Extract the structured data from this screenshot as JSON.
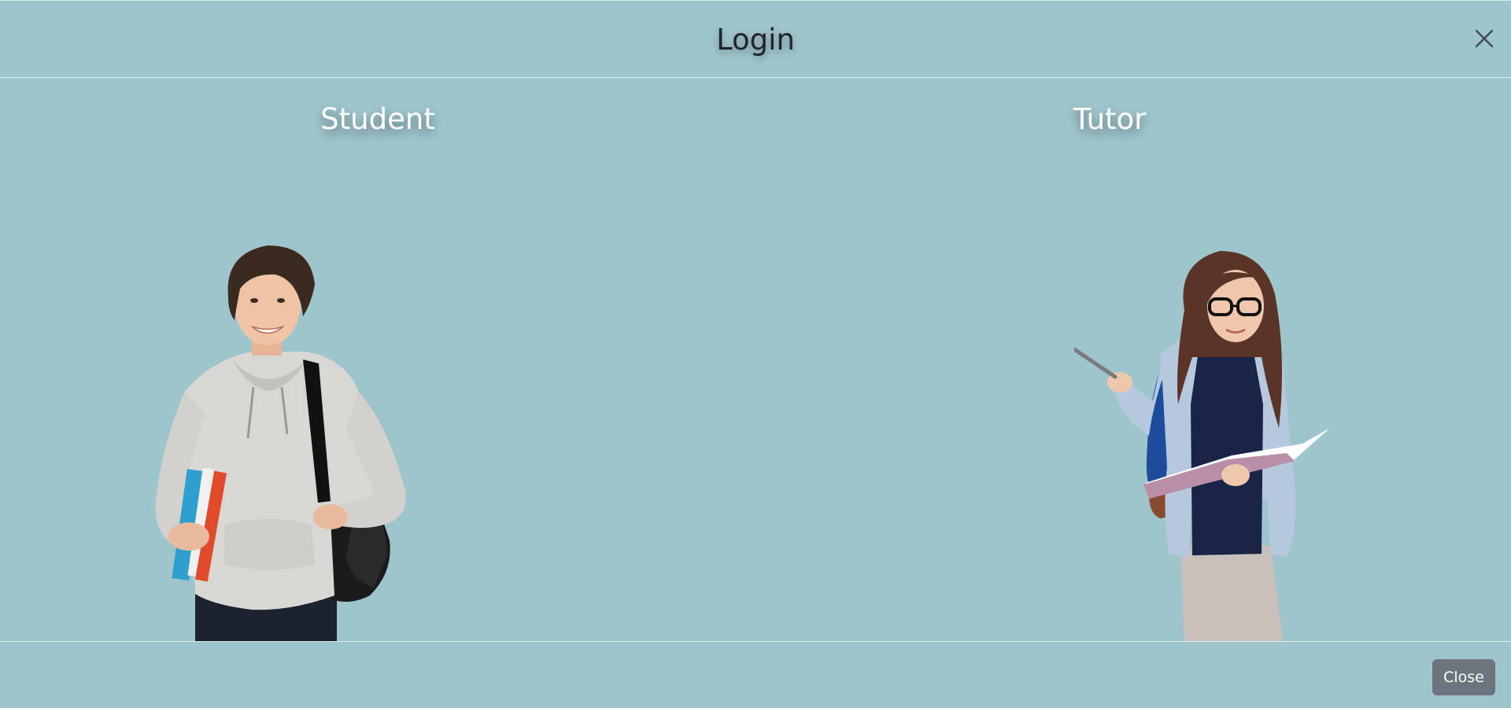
{
  "modal": {
    "title": "Login",
    "close_icon": "close-icon",
    "options": [
      {
        "label": "Student",
        "image": "student-photo"
      },
      {
        "label": "Tutor",
        "image": "tutor-photo"
      }
    ],
    "footer": {
      "close_label": "Close"
    }
  },
  "colors": {
    "background": "#9fc5cc",
    "title_text": "#212529",
    "option_text": "#ffffff",
    "close_button": "#6c757d"
  }
}
